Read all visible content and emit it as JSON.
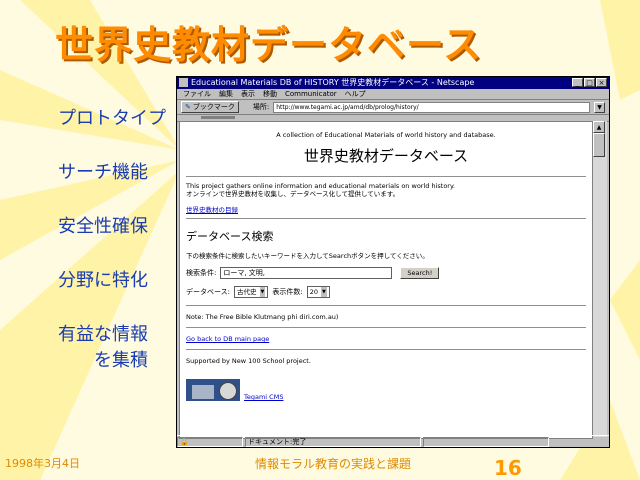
{
  "slide": {
    "title": "世界史教材データベース",
    "bullets": [
      {
        "lines": [
          "プロトタイプ"
        ]
      },
      {
        "lines": [
          "サーチ機能"
        ]
      },
      {
        "lines": [
          "安全性確保"
        ]
      },
      {
        "lines": [
          "分野に特化"
        ]
      },
      {
        "lines": [
          "有益な情報",
          "を集積"
        ]
      }
    ],
    "footer_date": "1998年3月4日",
    "footer_course": "情報モラル教育の実践と課題",
    "page_number": "16"
  },
  "browser": {
    "window_title": "Educational Materials DB of HISTORY 世界史教材データベース - Netscape",
    "menu": [
      "ファイル",
      "編集",
      "表示",
      "移動",
      "Communicator",
      "ヘルプ"
    ],
    "toolbar": {
      "bookmarks_label": "ブックマーク",
      "location_label": "場所:",
      "url": "http://www.tegami.ac.jp/amd/db/prolog/history/"
    },
    "status": [
      "ドキュメント:完了"
    ]
  },
  "page": {
    "subtitle_en": "A collection of Educational Materials of world history and database.",
    "heading": "世界史教材データベース",
    "description_en": "This project gathers online information and educational materials on world history.",
    "description_jp": "オンラインで世界史教材を収集し、データベース化して提供しています。",
    "link_list": "世界史教材の目録",
    "search_heading": "データベース検索",
    "search_instructions": "下の検索条件に検索したいキーワードを入力してSearchボタンを押してください。",
    "search_label": "検索条件:",
    "search_value": "ローマ, 文明,",
    "search_button": "Search!",
    "db_label": "データベース:",
    "db_value": "古代史",
    "count_label": "表示件数:",
    "count_value": "20",
    "note": "Note: The Free Bible Klutmang phi diri.com.au)",
    "back_link": "Go back to DB main page",
    "supported": "Supported by New 100 School project.",
    "banner_link": "Tegami CMS"
  },
  "colors": {
    "title": "#ff8c00",
    "bullet": "#1a3cb0",
    "titlebar": "#000080",
    "link": "#0000cc"
  }
}
